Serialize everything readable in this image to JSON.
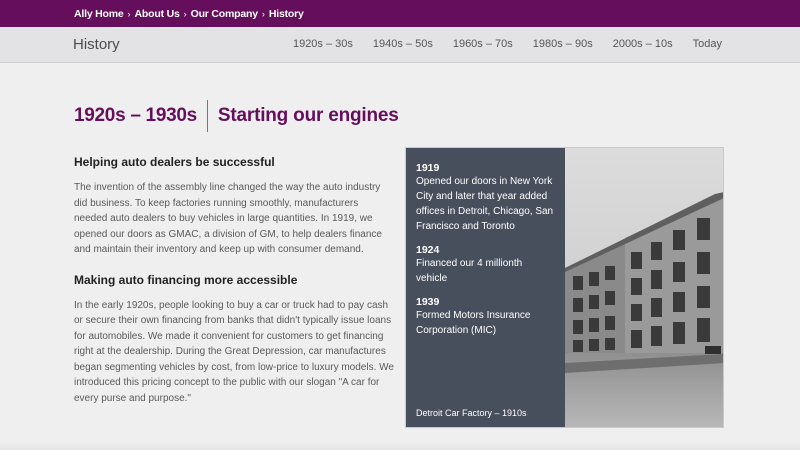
{
  "breadcrumb": {
    "items": [
      "Ally Home",
      "About Us",
      "Our Company",
      "History"
    ],
    "separator": "›"
  },
  "subnav": {
    "title": "History",
    "links": [
      "1920s – 30s",
      "1940s – 50s",
      "1960s – 70s",
      "1980s – 90s",
      "2000s – 10s",
      "Today"
    ]
  },
  "heading": {
    "era": "1920s – 1930s",
    "tagline": "Starting our engines"
  },
  "sections": [
    {
      "title": "Helping auto dealers be successful",
      "body": "The invention of the assembly line changed the way the auto industry did business. To keep factories running smoothly, manufacturers needed auto dealers to buy vehicles in large quantities. In 1919, we opened our doors as GMAC, a division of GM, to help dealers finance and maintain their inventory and keep up with consumer demand."
    },
    {
      "title": "Making auto financing more accessible",
      "body": "In the early 1920s, people looking to buy a car or truck had to pay cash or secure their own financing from banks that didn't typically issue loans for automobiles. We made it convenient for customers to get financing right at the dealership. During the Great Depression, car manufactures began segmenting vehicles by cost, from low-price to luxury models. We introduced this pricing concept to the public with our slogan \"A car for every purse and purpose.\""
    }
  ],
  "timeline": [
    {
      "year": "1919",
      "text": "Opened our doors in New York City and later that year added offices in Detroit, Chicago, San Francisco and Toronto"
    },
    {
      "year": "1924",
      "text": "Financed our 4 millionth vehicle"
    },
    {
      "year": "1939",
      "text": "Formed Motors Insurance Corporation (MIC)"
    }
  ],
  "photo": {
    "caption": "Detroit Car Factory – 1910s"
  },
  "colors": {
    "brand": "#650f5c",
    "panel": "#474f5d",
    "background": "#efeff0"
  }
}
